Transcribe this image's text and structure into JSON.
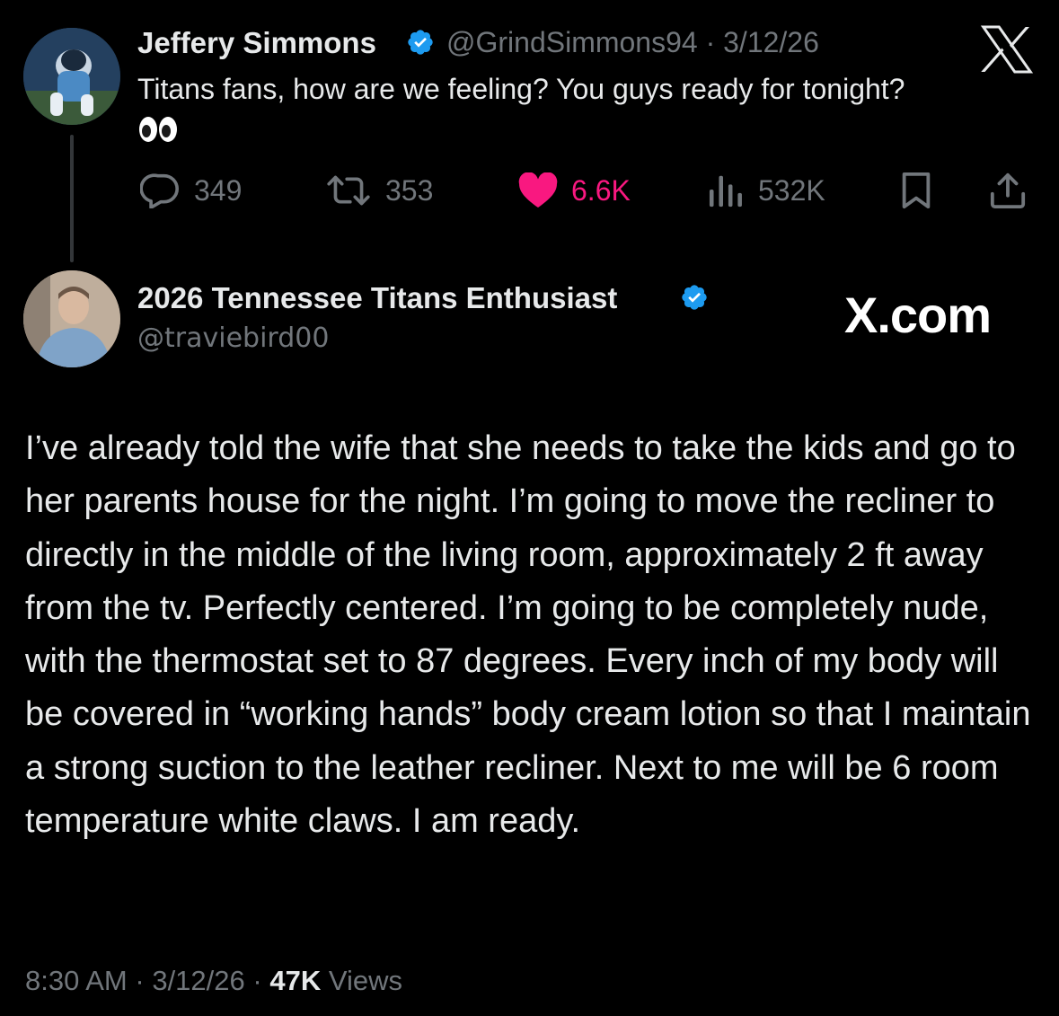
{
  "tweet1": {
    "author_name": "Jeffery Simmons",
    "handle": "@GrindSimmons94",
    "separator": "·",
    "date": "3/12/26",
    "text": "Titans fans, how are we feeling? You guys ready for tonight?",
    "emoji": "👀",
    "replies": "349",
    "reposts": "353",
    "likes": "6.6K",
    "views": "532K"
  },
  "tweet2": {
    "author_name": "2026 Tennessee Titans Enthusiast",
    "handle": "@traviebird00",
    "body": "I’ve already told the wife that she needs to take the kids and go to her parents house for the night. I’m going to move the recliner to directly in the middle of the living room, approximately 2 ft away from the tv. Perfectly centered. I’m going to be completely nude, with the thermostat set to 87 degrees. Every inch of my body will be covered in “working hands” body cream lotion so that I maintain a strong suction to the leather recliner. Next to me will be 6 room temperature white claws. I am ready.",
    "time": "8:30 AM",
    "separator": "·",
    "date": "3/12/26",
    "views_count": "47K",
    "views_label": "Views"
  },
  "watermark": "X.com",
  "icons": {
    "logo": "x-logo-icon",
    "verified": "verified-badge-icon",
    "reply": "reply-icon",
    "repost": "repost-icon",
    "like": "heart-icon",
    "views": "views-icon",
    "bookmark": "bookmark-icon",
    "share": "share-icon"
  },
  "colors": {
    "background": "#000000",
    "text": "#e7e9ea",
    "secondary": "#71767b",
    "like": "#f91880",
    "verified": "#1d9bf0"
  }
}
